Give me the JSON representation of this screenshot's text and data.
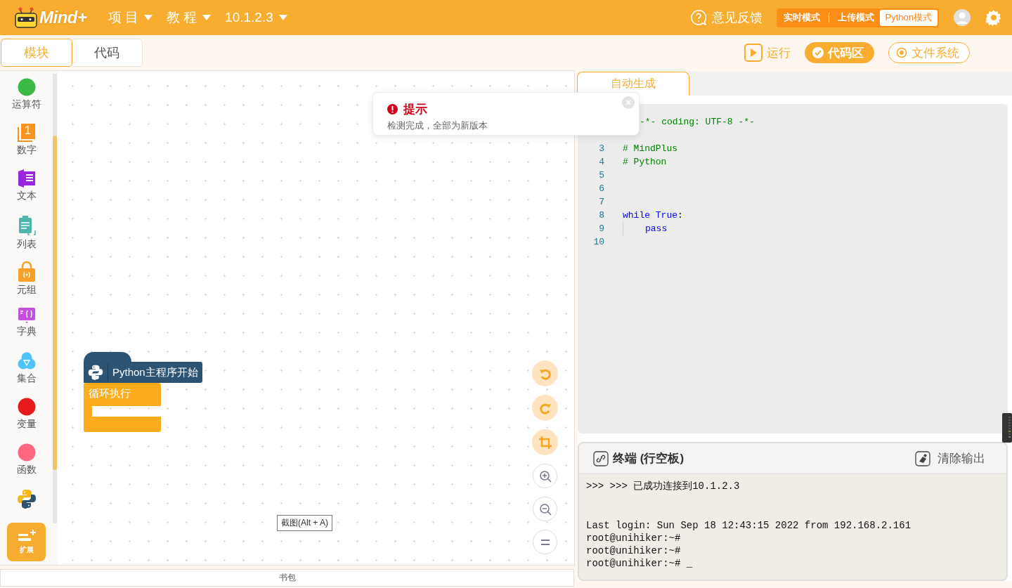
{
  "header": {
    "logo": "Mind+",
    "menus": [
      {
        "label": "项 目"
      },
      {
        "label": "教 程"
      },
      {
        "label": "10.1.2.3"
      }
    ],
    "feedback": "意见反馈",
    "modes": [
      {
        "label": "实时模式",
        "selected": false
      },
      {
        "label": "上传模式",
        "selected": false
      },
      {
        "label": "Python模式",
        "selected": true
      }
    ]
  },
  "view_tabs": [
    {
      "label": "模块",
      "selected": true
    },
    {
      "label": "代码",
      "selected": false
    }
  ],
  "actions": [
    {
      "label": "运行",
      "kind": "run",
      "selected": false
    },
    {
      "label": "代码区",
      "kind": "code",
      "selected": true
    },
    {
      "label": "文件系统",
      "kind": "files",
      "selected": false
    }
  ],
  "palette": [
    {
      "label": "运算符",
      "kind": "dot",
      "color": "#3cb944"
    },
    {
      "label": "数字",
      "kind": "number",
      "badge": "1"
    },
    {
      "label": "文本",
      "kind": "text"
    },
    {
      "label": "列表",
      "kind": "list"
    },
    {
      "label": "元组",
      "kind": "tuple"
    },
    {
      "label": "字典",
      "kind": "dict"
    },
    {
      "label": "集合",
      "kind": "set"
    },
    {
      "label": "变量",
      "kind": "dot",
      "color": "#e8191c"
    },
    {
      "label": "函数",
      "kind": "dot",
      "color": "#ff6680"
    },
    {
      "kind": "python"
    }
  ],
  "extension_button": "扩展",
  "canvas": {
    "blocks": [
      {
        "kind": "hat",
        "label": "Python主程序开始"
      },
      {
        "kind": "loop",
        "label": "循环执行"
      }
    ],
    "tools": [
      {
        "kind": "undo"
      },
      {
        "kind": "redo"
      },
      {
        "kind": "crop"
      },
      {
        "kind": "zoom_in"
      },
      {
        "kind": "zoom_out"
      },
      {
        "kind": "reset"
      }
    ],
    "tooltip": "截图(Alt + A)"
  },
  "backpack": "书包",
  "toast": {
    "title": "提示",
    "message": "检测完成，全部为新版本"
  },
  "code_tab": {
    "label": "自动生成",
    "selected": true
  },
  "code_lines": [
    {
      "clipped": true,
      "tokens": [
        {
          "text": "-*- coding: UTF-8 -*-",
          "kind": "comment"
        }
      ]
    },
    {
      "number": "3",
      "tokens": [
        {
          "text": "# MindPlus",
          "kind": "comment"
        }
      ]
    },
    {
      "number": "4",
      "tokens": [
        {
          "text": "# Python",
          "kind": "comment"
        }
      ]
    },
    {
      "number": "5"
    },
    {
      "number": "6"
    },
    {
      "number": "7"
    },
    {
      "number": "8",
      "tokens": [
        {
          "text": "while True",
          "kind": "keyword"
        },
        {
          "text": ":",
          "kind": "plain"
        }
      ]
    },
    {
      "number": "9",
      "indent": true,
      "tokens": [
        {
          "text": "pass",
          "kind": "keyword"
        }
      ]
    },
    {
      "number": "10"
    }
  ],
  "terminal": {
    "title": "终端 (行空板)",
    "clear": "清除输出",
    "groups": [
      [
        ">>> >>> 已成功连接到10.1.2.3"
      ],
      [
        "Last login: Sun Sep 18 12:43:15 2022 from 192.168.2.161",
        "root@unihiker:~#",
        "root@unihiker:~#",
        "root@unihiker:~# _"
      ]
    ]
  }
}
